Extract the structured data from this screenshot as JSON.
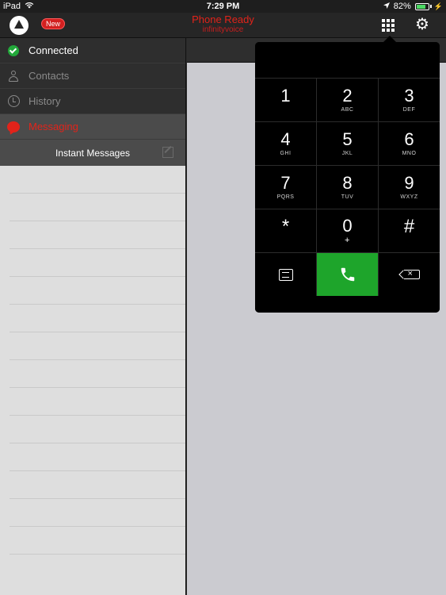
{
  "status_bar": {
    "device": "iPad",
    "time": "7:29 PM",
    "battery_text": "82%",
    "battery_level": 0.82
  },
  "header": {
    "badge": "New",
    "title": "Phone Ready",
    "subtitle": "infinityvoice"
  },
  "sidebar": {
    "items": [
      {
        "label": "Connected",
        "icon": "check-circle-icon"
      },
      {
        "label": "Contacts",
        "icon": "person-icon"
      },
      {
        "label": "History",
        "icon": "clock-icon"
      },
      {
        "label": "Messaging",
        "icon": "chat-bubble-icon"
      }
    ],
    "section_title": "Instant Messages"
  },
  "dialer": {
    "number": "",
    "keys": [
      {
        "digit": "1",
        "letters": ""
      },
      {
        "digit": "2",
        "letters": "ABC"
      },
      {
        "digit": "3",
        "letters": "DEF"
      },
      {
        "digit": "4",
        "letters": "GHI"
      },
      {
        "digit": "5",
        "letters": "JKL"
      },
      {
        "digit": "6",
        "letters": "MNO"
      },
      {
        "digit": "7",
        "letters": "PQRS"
      },
      {
        "digit": "8",
        "letters": "TUV"
      },
      {
        "digit": "9",
        "letters": "WXYZ"
      },
      {
        "digit": "*",
        "letters": ""
      },
      {
        "digit": "0",
        "letters": "+"
      },
      {
        "digit": "#",
        "letters": ""
      }
    ]
  },
  "colors": {
    "accent_red": "#e2231a",
    "call_green": "#1ea52b",
    "connected_green": "#22a83a"
  }
}
